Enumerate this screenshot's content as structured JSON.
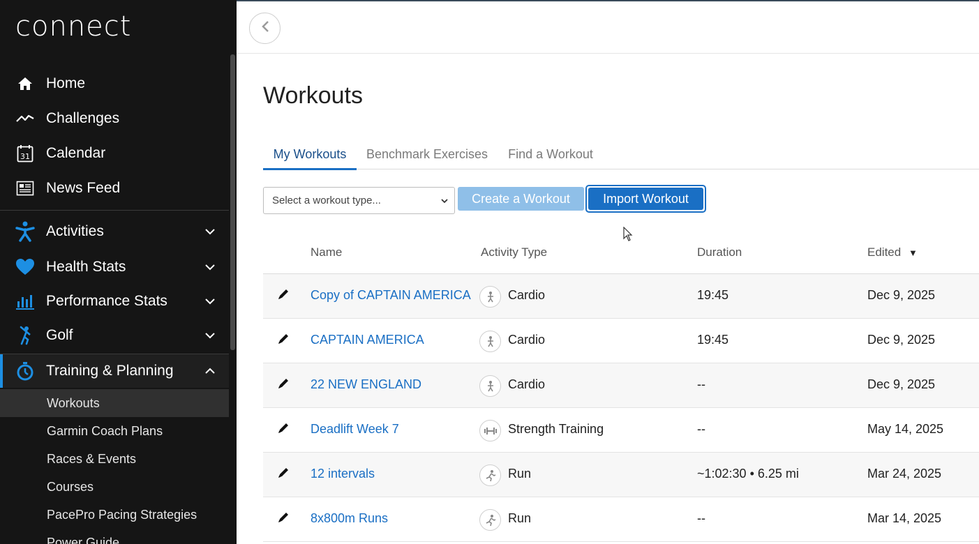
{
  "app": {
    "logo_text": "connect"
  },
  "sidebar": {
    "main_items": [
      {
        "label": "Home",
        "icon": "home-icon"
      },
      {
        "label": "Challenges",
        "icon": "challenges-icon"
      },
      {
        "label": "Calendar",
        "icon": "calendar-icon"
      },
      {
        "label": "News Feed",
        "icon": "news-feed-icon"
      }
    ],
    "section_items": [
      {
        "label": "Activities",
        "icon": "activities-icon",
        "expanded": false
      },
      {
        "label": "Health Stats",
        "icon": "heart-icon",
        "expanded": false
      },
      {
        "label": "Performance Stats",
        "icon": "bar-chart-icon",
        "expanded": false
      },
      {
        "label": "Golf",
        "icon": "golf-icon",
        "expanded": false
      },
      {
        "label": "Training & Planning",
        "icon": "stopwatch-icon",
        "expanded": true
      }
    ],
    "sub_items": [
      {
        "label": "Workouts",
        "selected": true
      },
      {
        "label": "Garmin Coach Plans",
        "selected": false
      },
      {
        "label": "Races & Events",
        "selected": false
      },
      {
        "label": "Courses",
        "selected": false
      },
      {
        "label": "PacePro Pacing Strategies",
        "selected": false
      },
      {
        "label": "Power Guide",
        "selected": false
      }
    ],
    "calendar_day": "31",
    "accent_color": "#1d8fe3"
  },
  "page": {
    "title": "Workouts",
    "tabs": [
      {
        "label": "My Workouts",
        "active": true
      },
      {
        "label": "Benchmark Exercises",
        "active": false
      },
      {
        "label": "Find a Workout",
        "active": false
      }
    ],
    "workout_type_select": {
      "placeholder": "Select a workout type..."
    },
    "create_button": "Create a Workout",
    "import_button": "Import Workout",
    "link_color": "#1a6fc4"
  },
  "table": {
    "columns": {
      "name": "Name",
      "activity_type": "Activity Type",
      "duration": "Duration",
      "edited": "Edited",
      "sort_indicator": "▼"
    },
    "rows": [
      {
        "name": "Copy of CAPTAIN AMERICA",
        "activity_type": "Cardio",
        "activity_icon": "cardio-icon",
        "duration": "19:45",
        "edited": "Dec 9, 2025"
      },
      {
        "name": "CAPTAIN AMERICA",
        "activity_type": "Cardio",
        "activity_icon": "cardio-icon",
        "duration": "19:45",
        "edited": "Dec 9, 2025"
      },
      {
        "name": "22 NEW ENGLAND",
        "activity_type": "Cardio",
        "activity_icon": "cardio-icon",
        "duration": "--",
        "edited": "Dec 9, 2025"
      },
      {
        "name": "Deadlift Week 7",
        "activity_type": "Strength Training",
        "activity_icon": "dumbbell-icon",
        "duration": "--",
        "edited": "May 14, 2025"
      },
      {
        "name": "12 intervals",
        "activity_type": "Run",
        "activity_icon": "run-icon",
        "duration": "~1:02:30 • 6.25 mi",
        "edited": "Mar 24, 2025"
      },
      {
        "name": "8x800m Runs",
        "activity_type": "Run",
        "activity_icon": "run-icon",
        "duration": "--",
        "edited": "Mar 14, 2025"
      }
    ]
  }
}
